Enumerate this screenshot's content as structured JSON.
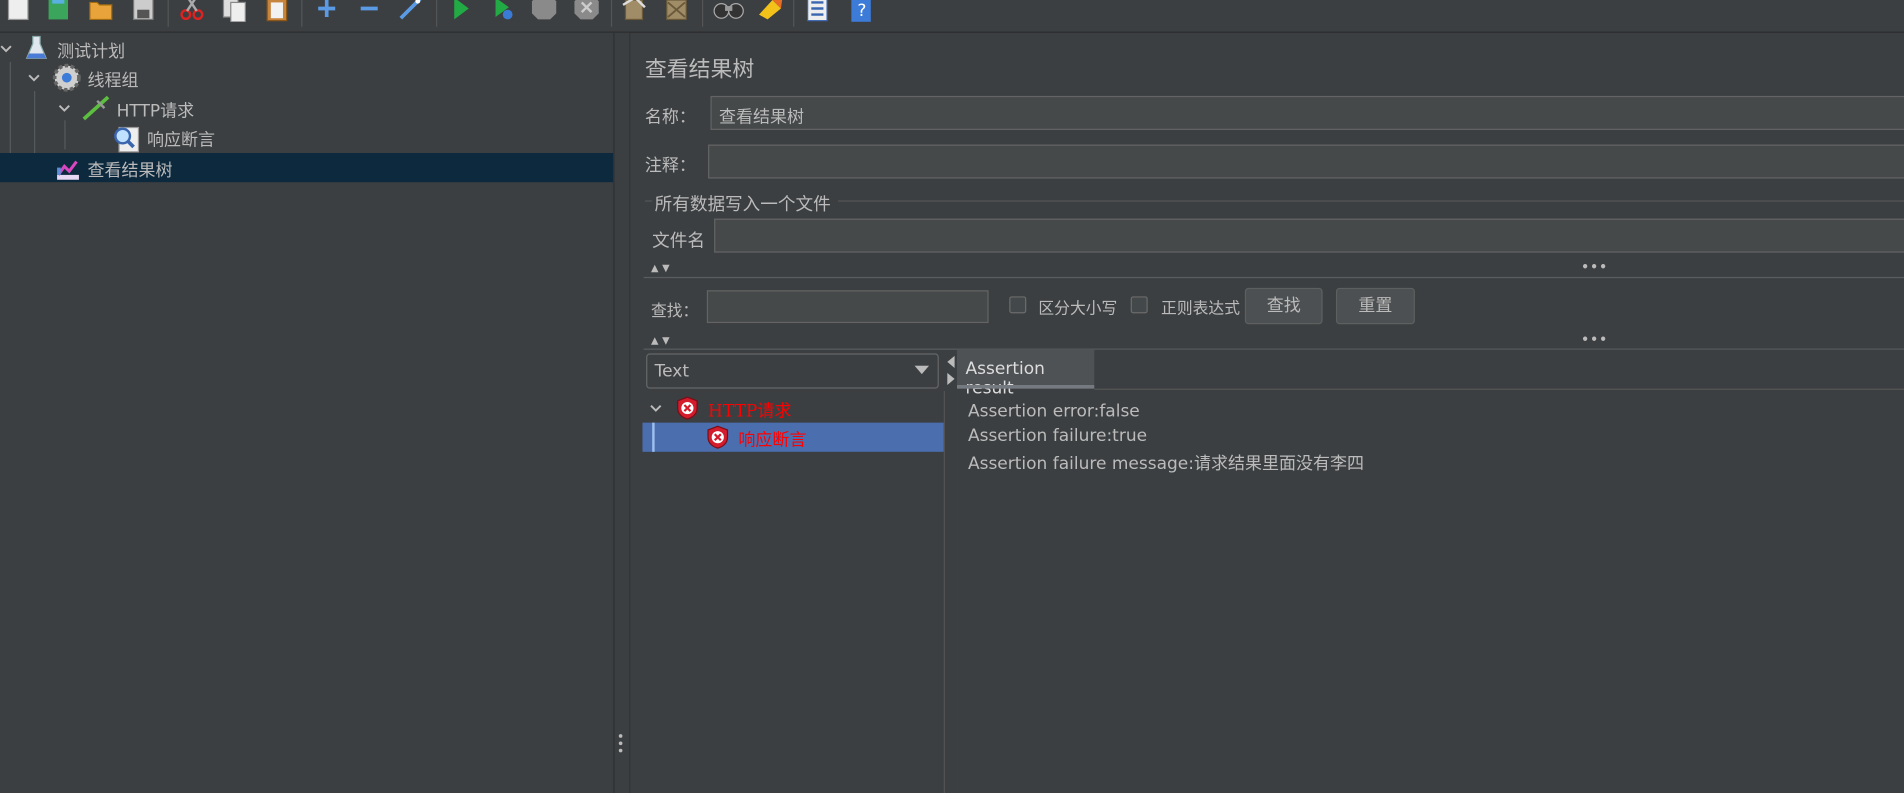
{
  "toolbar": {
    "buttons": [
      "new-icon",
      "templates-icon",
      "open-icon",
      "save-icon",
      "cut-icon",
      "copy-icon",
      "paste-icon",
      "expand-icon",
      "collapse-icon",
      "toggle-icon",
      "start-icon",
      "start-no-pause-icon",
      "stop-icon",
      "shutdown-icon",
      "clear-icon",
      "clear-all-icon",
      "search-icon",
      "reset-search-icon",
      "function-helper-icon",
      "help-icon"
    ]
  },
  "tree": {
    "items": [
      {
        "label": "测试计划",
        "icon": "test-plan-icon"
      },
      {
        "label": "线程组",
        "icon": "thread-group-icon"
      },
      {
        "label": "HTTP请求",
        "icon": "http-sampler-icon"
      },
      {
        "label": "响应断言",
        "icon": "assertion-icon"
      },
      {
        "label": "查看结果树",
        "icon": "results-tree-icon",
        "selected": true
      }
    ]
  },
  "panel": {
    "title": "查看结果树",
    "name_label": "名称：",
    "name_value": "查看结果树",
    "comment_label": "注释：",
    "comment_value": "",
    "file_group_title": "所有数据写入一个文件",
    "filename_label": "文件名",
    "filename_value": ""
  },
  "search": {
    "label": "查找：",
    "value": "",
    "case_sensitive_label": "区分大小写",
    "case_sensitive_checked": false,
    "regex_label": "正则表达式",
    "regex_checked": false,
    "find_button": "查找",
    "reset_button": "重置"
  },
  "renderer": {
    "selected": "Text"
  },
  "results": {
    "items": [
      {
        "label": "HTTP请求",
        "status": "failed"
      },
      {
        "label": "响应断言",
        "status": "failed",
        "selected": true
      }
    ]
  },
  "detail": {
    "tab_label": "Assertion result",
    "lines": [
      "Assertion error:false",
      "Assertion failure:true",
      "Assertion failure message:请求结果里面没有李四"
    ]
  },
  "colors": {
    "background": "#3c3f41",
    "selection_tree": "#0d293e",
    "selection_result": "#4b6eaf",
    "error_text": "#ff0000"
  }
}
